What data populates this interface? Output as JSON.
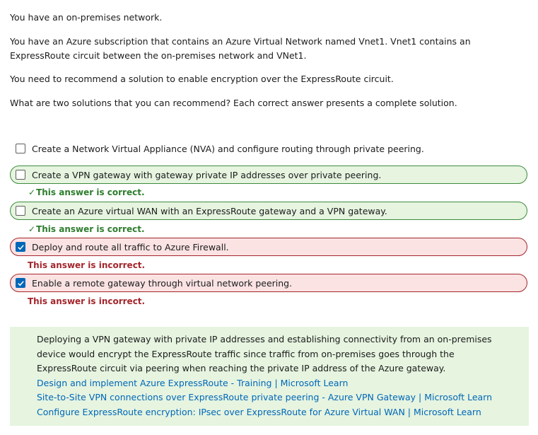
{
  "question": {
    "paragraphs": [
      "You have an on-premises network.",
      "You have an Azure subscription that contains an Azure Virtual Network named Vnet1. Vnet1 contains an ExpressRoute circuit between the on-premises network and VNet1.",
      "You need to recommend a solution to enable encryption over the ExpressRoute circuit.",
      "What are two solutions that you can recommend? Each correct answer presents a complete solution."
    ]
  },
  "options": [
    {
      "label": "Create a Network Virtual Appliance (NVA) and configure routing through private peering.",
      "checked": false,
      "state": "neutral"
    },
    {
      "label": "Create a VPN gateway with gateway private IP addresses over private peering.",
      "checked": false,
      "state": "correct",
      "feedback": "This answer is correct."
    },
    {
      "label": "Create an Azure virtual WAN with an ExpressRoute gateway and a VPN gateway.",
      "checked": false,
      "state": "correct",
      "feedback": "This answer is correct."
    },
    {
      "label": "Deploy and route all traffic to Azure Firewall.",
      "checked": true,
      "state": "incorrect",
      "feedback": "This answer is incorrect."
    },
    {
      "label": "Enable a remote gateway through virtual network peering.",
      "checked": true,
      "state": "incorrect",
      "feedback": "This answer is incorrect."
    }
  ],
  "explanation": {
    "text": "Deploying a VPN gateway with private IP addresses and establishing connectivity from an on-premises device would encrypt the ExpressRoute traffic since traffic from on-premises goes through the ExpressRoute circuit via peering when reaching the private IP address of the Azure gateway.",
    "links": [
      "Design and implement Azure ExpressRoute - Training | Microsoft Learn",
      "Site-to-Site VPN connections over ExpressRoute private peering - Azure VPN Gateway | Microsoft Learn",
      "Configure ExpressRoute encryption: IPsec over ExpressRoute for Azure Virtual WAN | Microsoft Learn"
    ]
  },
  "colors": {
    "correct": "#3d8b3d",
    "incorrect": "#a4262c",
    "link": "#0067b8",
    "checkbox": "#0067b8"
  }
}
